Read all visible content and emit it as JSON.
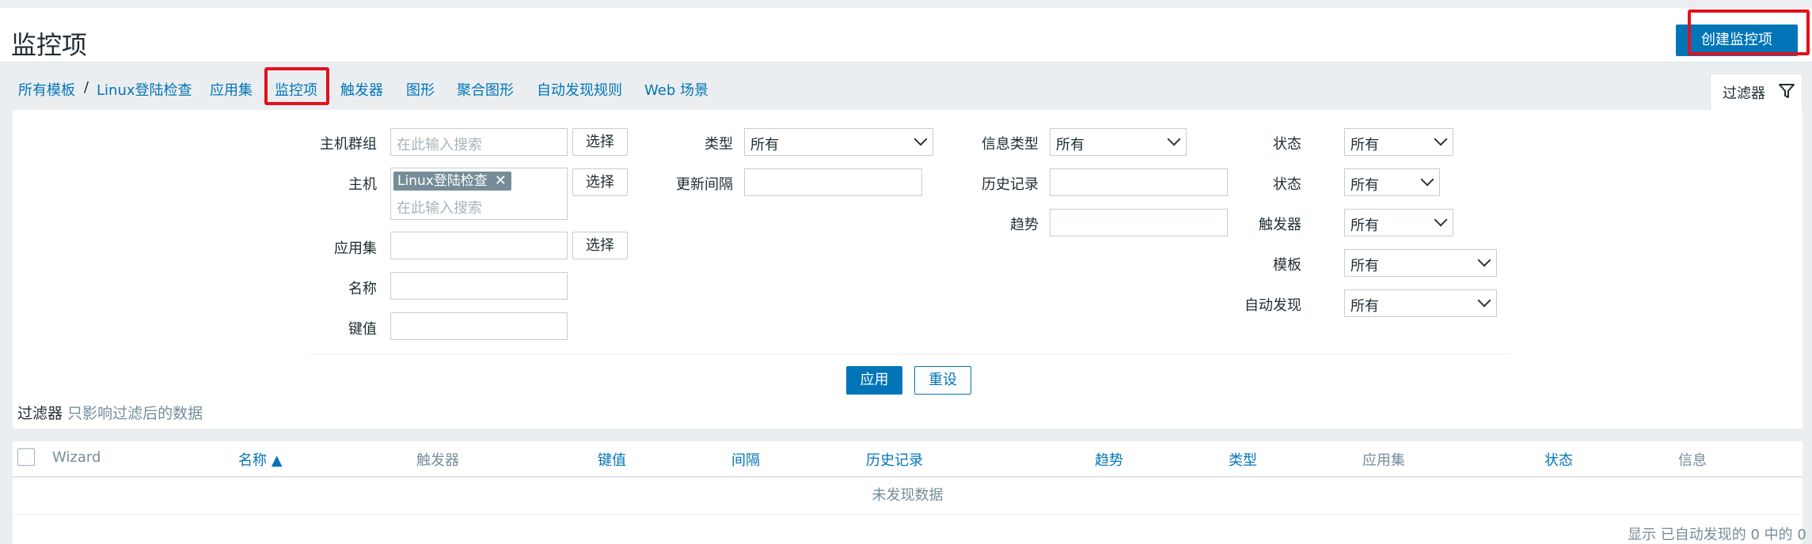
{
  "header": {
    "title": "监控项",
    "create_label": "创建监控项"
  },
  "breadcrumb": {
    "all_templates": "所有模板",
    "separator": "/",
    "template_name": "Linux登陆检查"
  },
  "tabs": [
    {
      "label": "应用集"
    },
    {
      "label": "监控项",
      "active": true
    },
    {
      "label": "触发器"
    },
    {
      "label": "图形"
    },
    {
      "label": "聚合图形"
    },
    {
      "label": "自动发现规则"
    },
    {
      "label": "Web 场景"
    }
  ],
  "filter_tab": {
    "label": "过滤器",
    "icon": "filter-icon"
  },
  "filter": {
    "host_group": {
      "label": "主机群组",
      "placeholder": "在此输入搜索",
      "select_label": "选择"
    },
    "host": {
      "label": "主机",
      "tag": "Linux登陆检查",
      "placeholder": "在此输入搜索",
      "select_label": "选择"
    },
    "application": {
      "label": "应用集",
      "value": "",
      "select_label": "选择"
    },
    "name": {
      "label": "名称",
      "value": ""
    },
    "key": {
      "label": "键值",
      "value": ""
    },
    "type": {
      "label": "类型",
      "value": "所有"
    },
    "update_interval": {
      "label": "更新间隔",
      "value": ""
    },
    "info_type": {
      "label": "信息类型",
      "value": "所有"
    },
    "history": {
      "label": "历史记录",
      "value": ""
    },
    "trends": {
      "label": "趋势",
      "value": ""
    },
    "status": {
      "label": "状态",
      "value": "所有"
    },
    "state": {
      "label": "状态",
      "value": "所有"
    },
    "triggers": {
      "label": "触发器",
      "value": "所有"
    },
    "template": {
      "label": "模板",
      "value": "所有"
    },
    "discovery": {
      "label": "自动发现",
      "value": "所有"
    },
    "apply_label": "应用",
    "reset_label": "重设",
    "note_title": "过滤器",
    "note_sub": "只影响过滤后的数据"
  },
  "table": {
    "columns": [
      "Wizard",
      "名称 ▲",
      "触发器",
      "键值",
      "间隔",
      "历史记录",
      "趋势",
      "类型",
      "应用集",
      "状态",
      "信息"
    ],
    "empty_text": "未发现数据",
    "footer": "显示 已自动发现的 0 中的 0"
  },
  "colors": {
    "accent": "#0275b8",
    "highlight": "#e0111d"
  }
}
